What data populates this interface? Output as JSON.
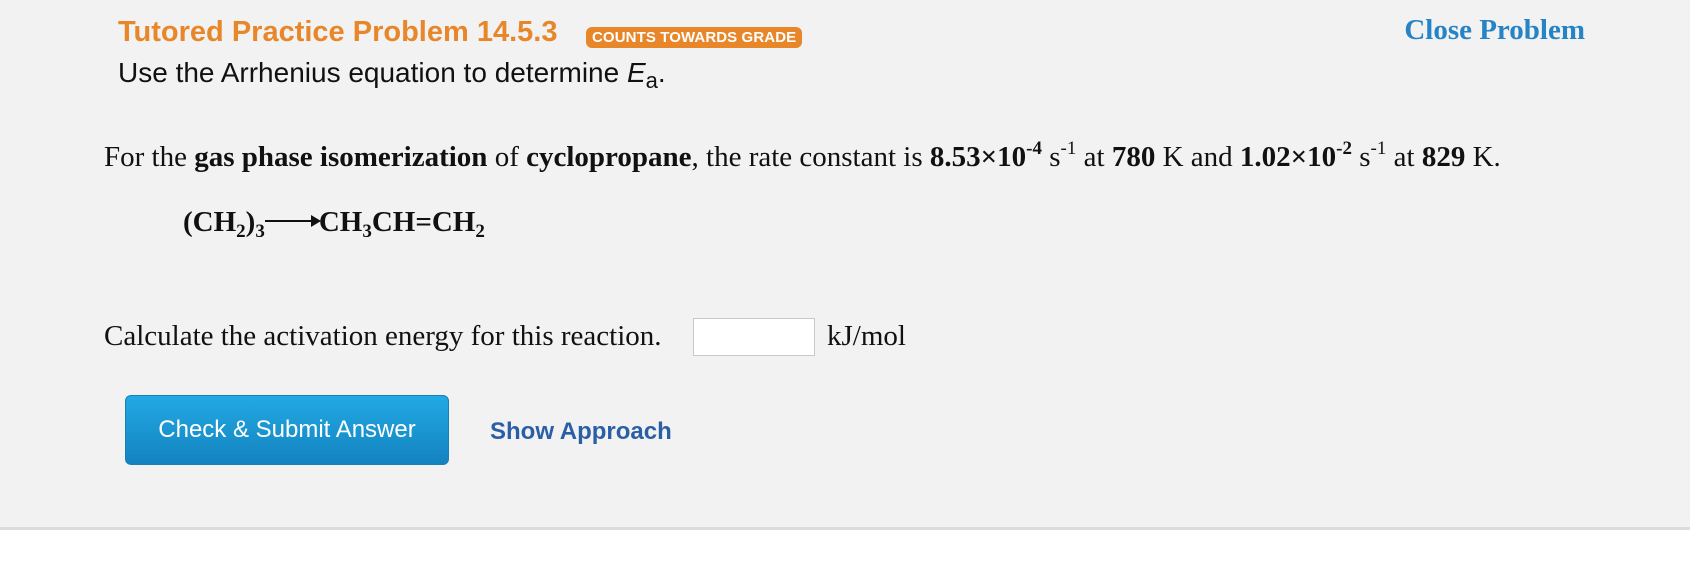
{
  "header": {
    "title": "Tutored Practice Problem 14.5.3",
    "badge": "COUNTS TOWARDS GRADE",
    "close_label": "Close Problem"
  },
  "subtitle": {
    "text": "Use the Arrhenius equation to determine ",
    "symbol": "E",
    "subscript": "a",
    "end": "."
  },
  "statement": {
    "p1": "For the ",
    "b1": "gas phase isomerization",
    "p2": " of ",
    "b2": "cyclopropane",
    "p3": ", the rate constant is ",
    "k1_mantissa": "8.53×10",
    "k1_exp": "-4",
    "unit_base": " s",
    "unit_exp": "-1",
    "p4": " at ",
    "t1": "780",
    "p5": " K and ",
    "k2_mantissa": "1.02×10",
    "k2_exp": "-2",
    "p6": " at ",
    "t2": "829",
    "p7": " K."
  },
  "reaction": {
    "reactant": "(CH",
    "reactant_sub": "2",
    "reactant_close": ")",
    "reactant_count": "3",
    "product_a": "CH",
    "product_a_sub": "3",
    "product_b": "CH=CH",
    "product_b_sub": "2"
  },
  "question": {
    "text": "Calculate the activation energy for this reaction.",
    "input_value": "",
    "unit": "kJ/mol"
  },
  "actions": {
    "submit_label": "Check & Submit Answer",
    "approach_label": "Show Approach"
  },
  "colors": {
    "title_orange": "#e8872a",
    "link_blue": "#2583c6",
    "button_blue": "#1a95d2",
    "approach_blue": "#2a5fa6",
    "panel_bg": "#f2f2f2"
  }
}
